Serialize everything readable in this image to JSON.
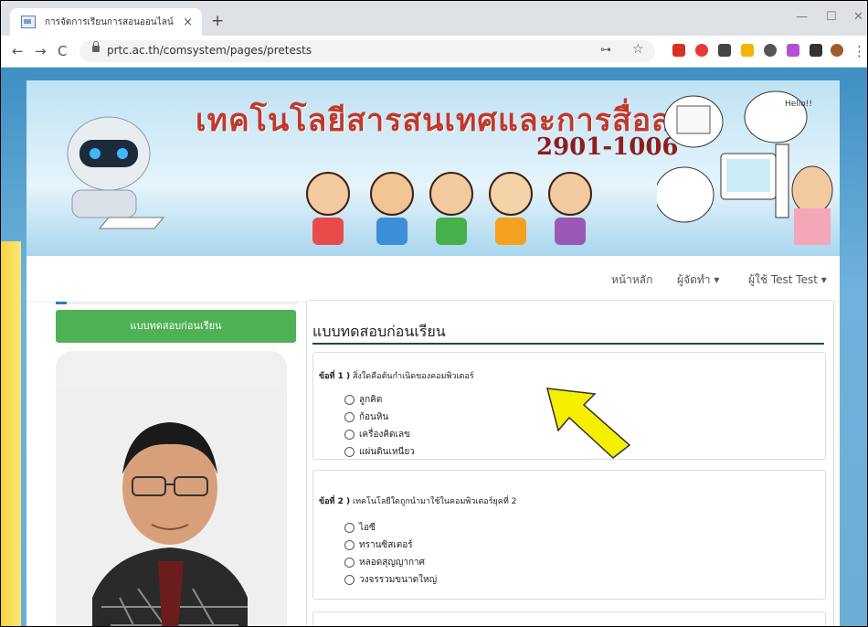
{
  "browser": {
    "tab_title": "การจัดการเรียนการสอนออนไลน์",
    "tab_close": "×",
    "new_tab": "+",
    "url": "prtc.ac.th/comsystem/pages/pretests",
    "back": "←",
    "forward": "→",
    "reload": "C",
    "key_icon": "⊶",
    "star_icon": "☆",
    "min": "—",
    "max": "☐",
    "close": "✕",
    "menu": "⋮"
  },
  "banner": {
    "title": "เทคโนโลยีสารสนเทศและการสื่อสาร",
    "code": "2901-1006",
    "speech": "Hello!!"
  },
  "navbar": {
    "home": "หน้าหลัก",
    "author": "ผู้จัดทำ ▾",
    "user": "ผู้ใช้ Test Test ▾"
  },
  "sidebar": {
    "button_label": "แบบทดสอบก่อนเรียน"
  },
  "main": {
    "heading": "แบบทดสอบก่อนเรียน",
    "questions": [
      {
        "prefix": "ข้อที่ 1 )",
        "text": "สิ่งใดคือต้นกำเนิดของคอมพิวเตอร์",
        "options": [
          "ลูกคิด",
          "ก้อนหิน",
          "เครื่องคิดเลข",
          "แผ่นดินเหนียว"
        ]
      },
      {
        "prefix": "ข้อที่ 2 )",
        "text": "เทคโนโลยีใดถูกนำมาใช้ในคอมพิวเตอร์ยุคที่ 2",
        "options": [
          "ไอซี",
          "ทรานซิสเตอร์",
          "หลอดสุญญากาศ",
          "วงจรรวมขนาดใหญ่"
        ]
      }
    ]
  },
  "colors": {
    "sidebar_button": "#4fb155",
    "heading_rule": "#1f4d2e",
    "arrow": "#f5f000"
  }
}
